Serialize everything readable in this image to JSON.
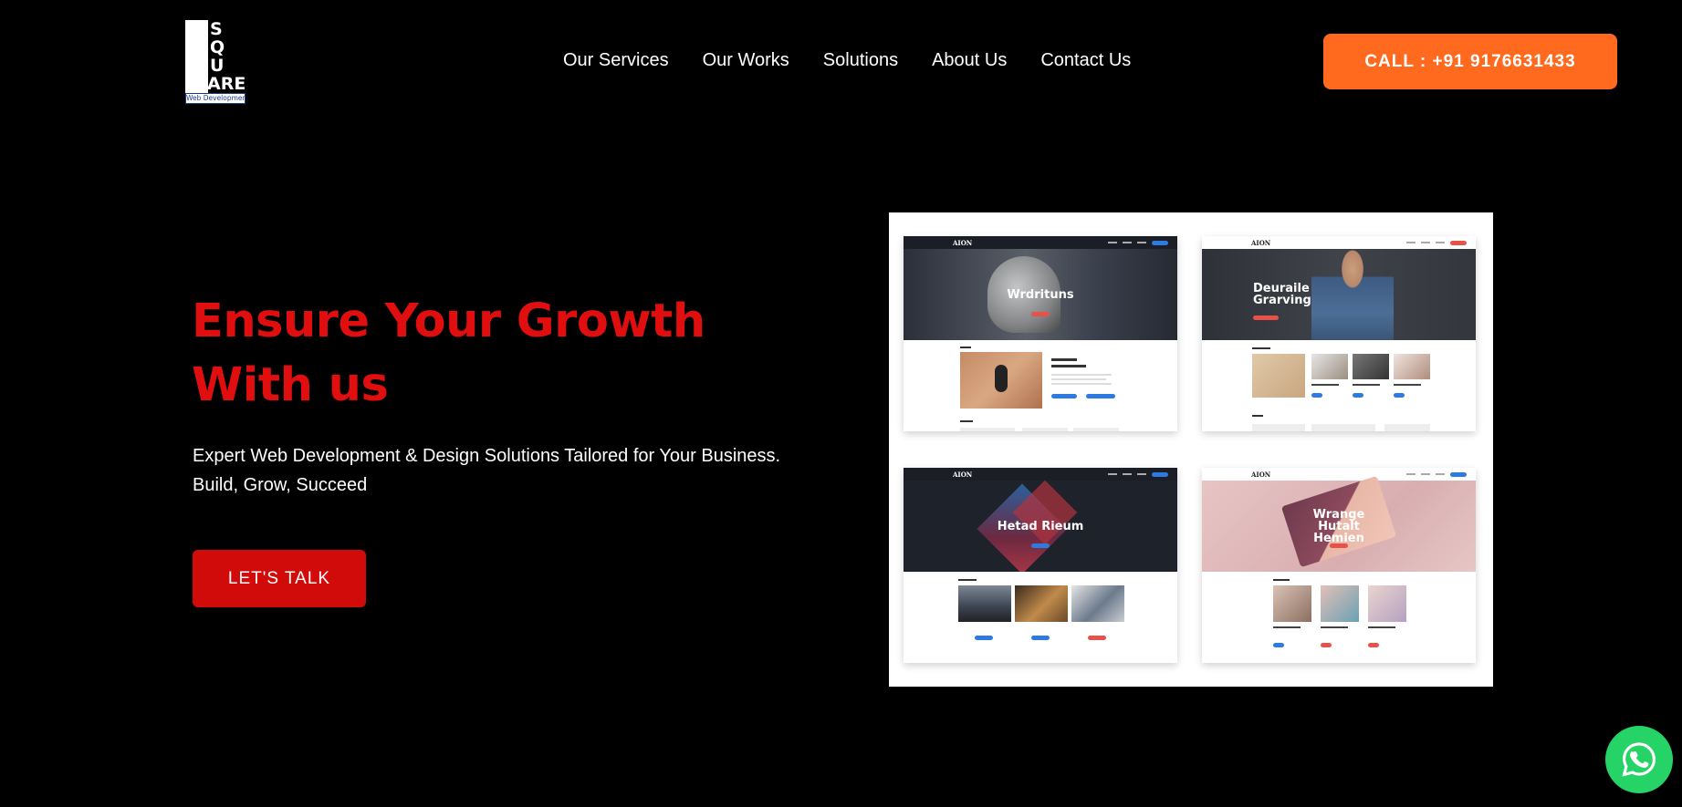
{
  "logo": {
    "letters": [
      "S",
      "Q",
      "U",
      "ARE"
    ],
    "tagline": "Web Development"
  },
  "nav": {
    "items": [
      {
        "label": "Our Services"
      },
      {
        "label": "Our Works"
      },
      {
        "label": "Solutions"
      },
      {
        "label": "About Us"
      },
      {
        "label": "Contact Us"
      }
    ]
  },
  "cta": {
    "call_label": "CALL : +91 9176631433",
    "color": "#ff6a1f"
  },
  "hero": {
    "title_line1": "Ensure Your Growth",
    "title_line2": "With us",
    "subtitle_line1": "Expert Web Development & Design Solutions Tailored for Your Business.",
    "subtitle_line2": "Build, Grow, Succeed",
    "button_label": "LET'S TALK",
    "title_color": "#e00e0e",
    "button_color": "#d10a0a"
  },
  "mockup": {
    "cards": [
      {
        "brand": "AION",
        "banner_text": "Wrdrituns"
      },
      {
        "brand": "AION",
        "banner_text": "Deuraile Grarving"
      },
      {
        "brand": "AION",
        "banner_text": "Hetad Rieum"
      },
      {
        "brand": "AION",
        "banner_text": "Wrange Hutalt Hemien"
      }
    ]
  },
  "whatsapp": {
    "icon": "whatsapp-icon",
    "color": "#25d366"
  }
}
